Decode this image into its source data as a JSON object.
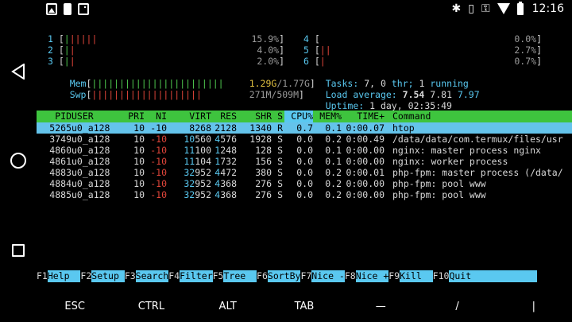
{
  "status_bar": {
    "left_icons": [
      "image-icon",
      "download-icon",
      "terminal-icon"
    ],
    "right_icons": [
      "bluetooth-icon",
      "vibrate-icon",
      "key-icon",
      "wifi-icon",
      "battery-icon"
    ],
    "time": "12:16"
  },
  "cpu_left": [
    {
      "label": "1",
      "bars": "||||||",
      "value": "15.9%"
    },
    {
      "label": "2",
      "bars": "||",
      "value": "4.0%"
    },
    {
      "label": "3",
      "bars": "||",
      "value": "2.0%"
    }
  ],
  "mem": {
    "label": "Mem",
    "bars": "||||||||||||||||||||||||",
    "value_used": "1.29G",
    "value_total": "/1.77G"
  },
  "swp": {
    "label": "Swp",
    "bars": "||||||||||||||||||||",
    "value": "271M/509M"
  },
  "cpu_right": [
    {
      "label": "4",
      "bars": "",
      "value": "0.0%"
    },
    {
      "label": "5",
      "bars": "||",
      "value": "2.7%"
    },
    {
      "label": "6",
      "bars": "|",
      "value": "0.7%"
    }
  ],
  "summary": {
    "tasks_label": "Tasks:",
    "tasks": "7,",
    "thr": "0",
    "thr_label": "thr;",
    "running": "1",
    "running_label": "running",
    "load_label": "Load average:",
    "load1": "7.54",
    "load5": "7.81",
    "load15": "7.97",
    "uptime_label": "Uptime:",
    "uptime": "1 day, 02:35:49"
  },
  "table": {
    "headers": [
      "PID",
      "USER",
      "PRI",
      "NI",
      "VIRT",
      "RES",
      "SHR",
      "S",
      "CPU%",
      "MEM%",
      "TIME+",
      "Command"
    ],
    "rows": [
      {
        "pid": "5265",
        "user": "u0_a128",
        "pri": "10",
        "ni": "-10",
        "virt_hi": "",
        "virt_lo": "8268",
        "res_hi": "",
        "res_lo": "2128",
        "shr": "1340",
        "s": "R",
        "cpu": "0.7",
        "mem": "0.1",
        "time": "0:00.07",
        "cmd": "htop"
      },
      {
        "pid": "3749",
        "user": "u0_a128",
        "pri": "10",
        "ni": "-10",
        "virt_hi": "10",
        "virt_lo": "560",
        "res_hi": "4",
        "res_lo": "576",
        "shr": "1928",
        "s": "S",
        "cpu": "0.0",
        "mem": "0.2",
        "time": "0:00.49",
        "cmd": "/data/data/com.termux/files/usr"
      },
      {
        "pid": "4860",
        "user": "u0_a128",
        "pri": "10",
        "ni": "-10",
        "virt_hi": "11",
        "virt_lo": "100",
        "res_hi": "1",
        "res_lo": "248",
        "shr": "128",
        "s": "S",
        "cpu": "0.0",
        "mem": "0.1",
        "time": "0:00.00",
        "cmd": "nginx: master process nginx"
      },
      {
        "pid": "4861",
        "user": "u0_a128",
        "pri": "10",
        "ni": "-10",
        "virt_hi": "11",
        "virt_lo": "104",
        "res_hi": "1",
        "res_lo": "732",
        "shr": "156",
        "s": "S",
        "cpu": "0.0",
        "mem": "0.1",
        "time": "0:00.00",
        "cmd": "nginx: worker process"
      },
      {
        "pid": "4883",
        "user": "u0_a128",
        "pri": "10",
        "ni": "-10",
        "virt_hi": "32",
        "virt_lo": "952",
        "res_hi": "4",
        "res_lo": "472",
        "shr": "380",
        "s": "S",
        "cpu": "0.0",
        "mem": "0.2",
        "time": "0:00.01",
        "cmd": "php-fpm: master process (/data/"
      },
      {
        "pid": "4884",
        "user": "u0_a128",
        "pri": "10",
        "ni": "-10",
        "virt_hi": "32",
        "virt_lo": "952",
        "res_hi": "4",
        "res_lo": "368",
        "shr": "276",
        "s": "S",
        "cpu": "0.0",
        "mem": "0.2",
        "time": "0:00.00",
        "cmd": "php-fpm: pool www"
      },
      {
        "pid": "4885",
        "user": "u0_a128",
        "pri": "10",
        "ni": "-10",
        "virt_hi": "32",
        "virt_lo": "952",
        "res_hi": "4",
        "res_lo": "368",
        "shr": "276",
        "s": "S",
        "cpu": "0.0",
        "mem": "0.2",
        "time": "0:00.00",
        "cmd": "php-fpm: pool www"
      }
    ]
  },
  "function_keys": [
    {
      "num": "F1",
      "label": "Help  "
    },
    {
      "num": "F2",
      "label": "Setup "
    },
    {
      "num": "F3",
      "label": "Search"
    },
    {
      "num": "F4",
      "label": "Filter"
    },
    {
      "num": "F5",
      "label": "Tree  "
    },
    {
      "num": "F6",
      "label": "SortBy"
    },
    {
      "num": "F7",
      "label": "Nice -"
    },
    {
      "num": "F8",
      "label": "Nice +"
    },
    {
      "num": "F9",
      "label": "Kill  "
    },
    {
      "num": "F10",
      "label": "Quit            "
    }
  ],
  "extra_keys": [
    "ESC",
    "CTRL",
    "ALT",
    "TAB",
    "—",
    "/",
    "|"
  ],
  "colors": {
    "header_green": "#3ec43e",
    "selection_cyan": "#64c3eb",
    "bar_green": "#4fc94f",
    "bar_red": "#e0453a",
    "label_cyan": "#59c8f0"
  }
}
